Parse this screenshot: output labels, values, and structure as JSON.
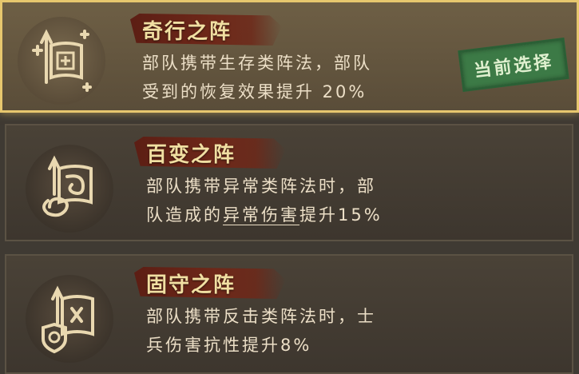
{
  "formations": [
    {
      "title": "奇行之阵",
      "desc_line1": "部队携带生存类阵法，部队",
      "desc_line2": "受到的恢复效果提升 20%",
      "selected_badge": "当前选择",
      "icon": "healing-flag-icon",
      "selected": true
    },
    {
      "title": "百变之阵",
      "desc_line1": "部队携带异常类阵法时，部",
      "desc_line2_pre": "队造成的",
      "desc_line2_link": "异常伤害",
      "desc_line2_post": "提升15%",
      "icon": "spiral-flag-icon",
      "selected": false
    },
    {
      "title": "固守之阵",
      "desc_line1": "部队携带反击类阵法时，士",
      "desc_line2": "兵伤害抗性提升8%",
      "icon": "shield-flag-icon",
      "selected": false
    }
  ],
  "colors": {
    "selected_border": "#e7c76e",
    "ribbon": "#6e2819",
    "badge": "#3c7a46"
  }
}
